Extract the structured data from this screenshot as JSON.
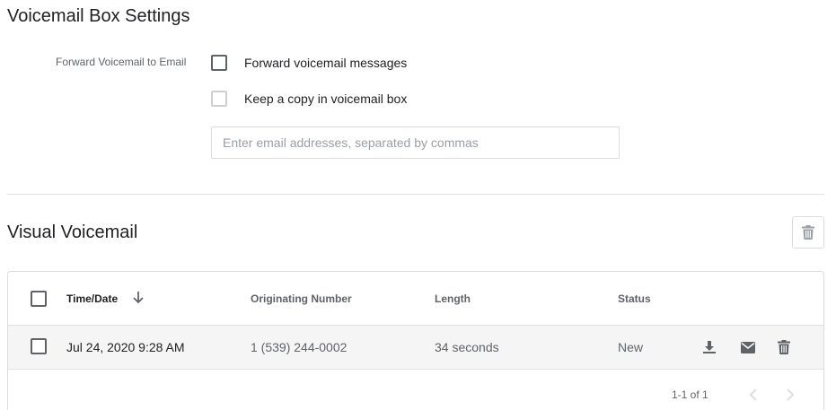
{
  "settings": {
    "title": "Voicemail Box Settings",
    "forward_label": "Forward Voicemail to Email",
    "forward_checkbox_label": "Forward voicemail messages",
    "forward_checked": false,
    "keep_copy_label": "Keep a copy in voicemail box",
    "keep_copy_checked": false,
    "keep_copy_disabled": true,
    "email_input": {
      "value": "",
      "placeholder": "Enter email addresses, separated by commas"
    }
  },
  "visual": {
    "title": "Visual Voicemail",
    "delete_icon": "trash-icon",
    "columns": [
      "Time/Date",
      "Originating Number",
      "Length",
      "Status"
    ],
    "sort_icon": "arrow-down-icon",
    "rows": [
      {
        "time_date": "Jul 24, 2020 9:28 AM",
        "number": "1 (539) 244-0002",
        "length": "34 seconds",
        "status": "New",
        "actions": [
          "download-icon",
          "email-icon",
          "trash-icon"
        ]
      }
    ],
    "pagination": {
      "range": "1-1 of 1",
      "prev_icon": "chevron-left-icon",
      "next_icon": "chevron-right-icon"
    }
  },
  "colors": {
    "icon": "#5f6368",
    "border": "#dadce0",
    "row_bg": "#f5f5f5",
    "disabled": "#cfcfcf"
  }
}
